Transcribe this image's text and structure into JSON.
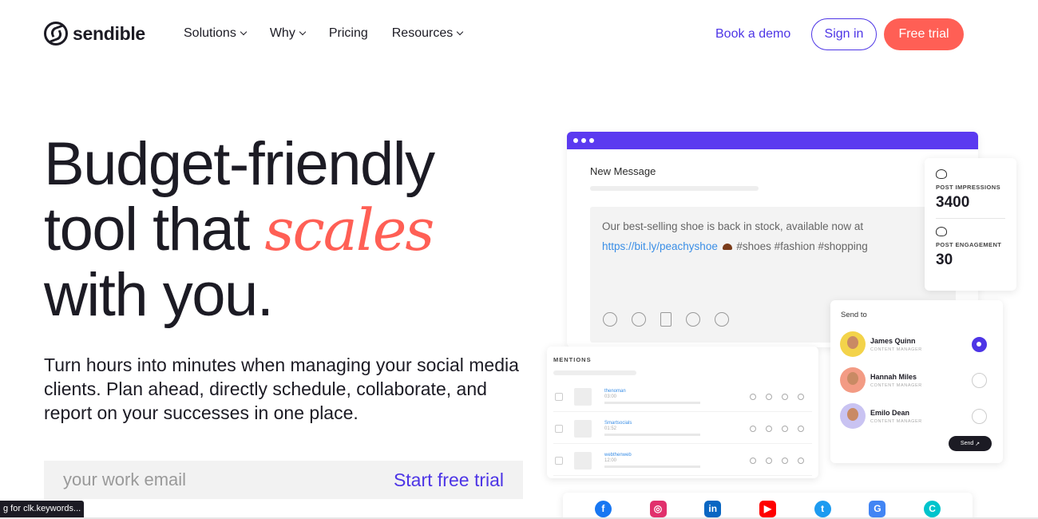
{
  "brand": {
    "name": "sendible"
  },
  "nav": {
    "items": [
      {
        "label": "Solutions",
        "dropdown": true
      },
      {
        "label": "Why",
        "dropdown": true
      },
      {
        "label": "Pricing",
        "dropdown": false
      },
      {
        "label": "Resources",
        "dropdown": true
      }
    ],
    "book_demo": "Book a demo",
    "sign_in": "Sign in",
    "free_trial": "Free trial"
  },
  "hero": {
    "title_line1": "Budget-friendly",
    "title_line2_pre": "tool that ",
    "title_accent": "scales",
    "title_line3": "with you.",
    "subtitle": "Turn hours into minutes when managing your social media clients. Plan ahead, directly schedule, collaborate, and report on your successes in one place.",
    "email_placeholder": "your work email",
    "cta": "Start free trial"
  },
  "status_bar": {
    "text": "g for clk.keywords..."
  },
  "mockup": {
    "compose_title": "New Message",
    "message_text": "Our best-selling shoe is back in stock, available now at",
    "message_link": "https://bit.ly/peachyshoe",
    "message_tags": "#shoes #fashion #shopping",
    "stats": [
      {
        "label": "POST IMPRESSIONS",
        "value": "3400"
      },
      {
        "label": "POST ENGAGEMENT",
        "value": "30"
      }
    ],
    "mentions_title": "MENTIONS",
    "mentions": [
      {
        "handle": "thenoman",
        "time": "03:00"
      },
      {
        "handle": "Smartsocials",
        "time": "01:52"
      },
      {
        "handle": "webthenweb",
        "time": "12:00"
      }
    ],
    "send_to_title": "Send to",
    "recipients": [
      {
        "name": "James Quinn",
        "role": "CONTENT MANAGER",
        "selected": true,
        "avatar_bg": "#f3d34a"
      },
      {
        "name": "Hannah Miles",
        "role": "CONTENT MANAGER",
        "selected": false,
        "avatar_bg": "#f39b84"
      },
      {
        "name": "Emilo Dean",
        "role": "CONTENT MANAGER",
        "selected": false,
        "avatar_bg": "#c9c3f2"
      }
    ],
    "send_label": "Send",
    "socials": [
      {
        "icon": "facebook-icon",
        "glyph": "f",
        "color": "#1877f2"
      },
      {
        "icon": "instagram-icon",
        "glyph": "◎",
        "color": "#e1306c"
      },
      {
        "icon": "linkedin-icon",
        "glyph": "in",
        "color": "#0a66c2"
      },
      {
        "icon": "youtube-icon",
        "glyph": "▶",
        "color": "#ff0000"
      },
      {
        "icon": "twitter-icon",
        "glyph": "t",
        "color": "#1d9bf0"
      },
      {
        "icon": "google-business-icon",
        "glyph": "G",
        "color": "#4285f4"
      },
      {
        "icon": "canva-icon",
        "glyph": "C",
        "color": "#00c4cc"
      }
    ]
  },
  "colors": {
    "accent": "#4d35e6",
    "coral": "#ff5f55",
    "text": "#1c1b24"
  }
}
